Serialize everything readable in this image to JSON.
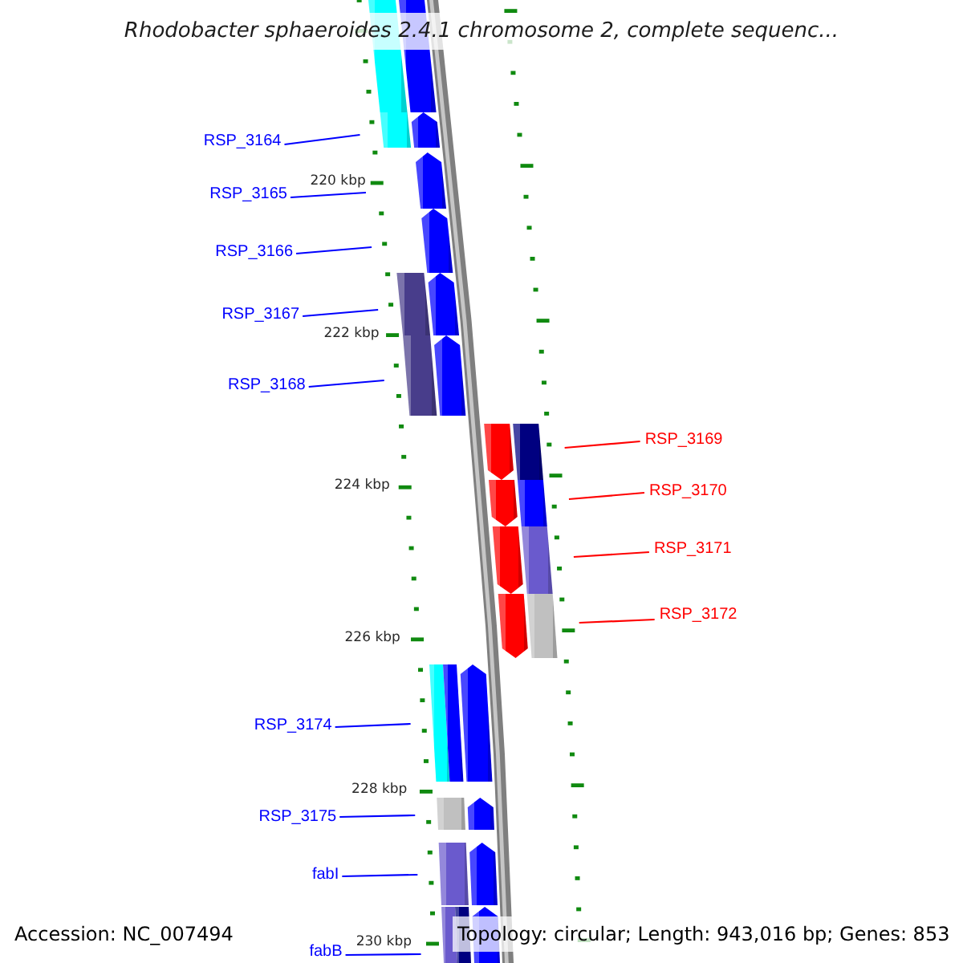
{
  "title": "Rhodobacter sphaeroides 2.4.1 chromosome 2, complete sequenc...",
  "map": {
    "ruler_labels": [
      "220 kbp",
      "222 kbp",
      "224 kbp",
      "226 kbp",
      "228 kbp",
      "230 kbp"
    ],
    "genes": [
      {
        "kind": "forward",
        "categories": [
          {
            "color": "#00ffff"
          }
        ]
      },
      {
        "label": "RSP_3164",
        "kind": "forward",
        "categories": [
          {
            "color": "#00ffff"
          }
        ]
      },
      {
        "label": "RSP_3165",
        "kind": "forward"
      },
      {
        "label": "RSP_3166",
        "kind": "forward"
      },
      {
        "label": "RSP_3167",
        "kind": "forward",
        "categories": [
          {
            "color": "#483d8b"
          }
        ]
      },
      {
        "label": "RSP_3168",
        "kind": "forward",
        "categories": [
          {
            "color": "#483d8b"
          }
        ]
      },
      {
        "label": "RSP_3169",
        "kind": "reverse",
        "categories": [
          {
            "color": "#000080"
          }
        ]
      },
      {
        "label": "RSP_3170",
        "kind": "reverse",
        "categories": [
          {
            "color": "#0000ff"
          }
        ]
      },
      {
        "label": "RSP_3171",
        "kind": "reverse",
        "categories": [
          {
            "color": "#6a5acd"
          }
        ]
      },
      {
        "label": "RSP_3172",
        "kind": "reverse",
        "categories": [
          {
            "color": "#c0c0c0"
          }
        ]
      },
      {
        "label": "RSP_3174",
        "kind": "forward",
        "categories": [
          {
            "color": "#00ffff"
          },
          {
            "color": "#0000ff"
          }
        ]
      },
      {
        "label": "RSP_3175",
        "kind": "forward",
        "categories": [
          {
            "color": "#c0c0c0"
          }
        ]
      },
      {
        "label": "fabI",
        "kind": "forward",
        "categories": [
          {
            "color": "#6a5acd"
          }
        ]
      },
      {
        "label": "fabB",
        "kind": "forward",
        "categories": [
          {
            "color": "#6a5acd"
          },
          {
            "color": "#000080"
          }
        ]
      }
    ]
  },
  "accession": "Accession: NC_007494",
  "topology": "Topology: circular; Length: 943,016 bp; Genes: 853"
}
